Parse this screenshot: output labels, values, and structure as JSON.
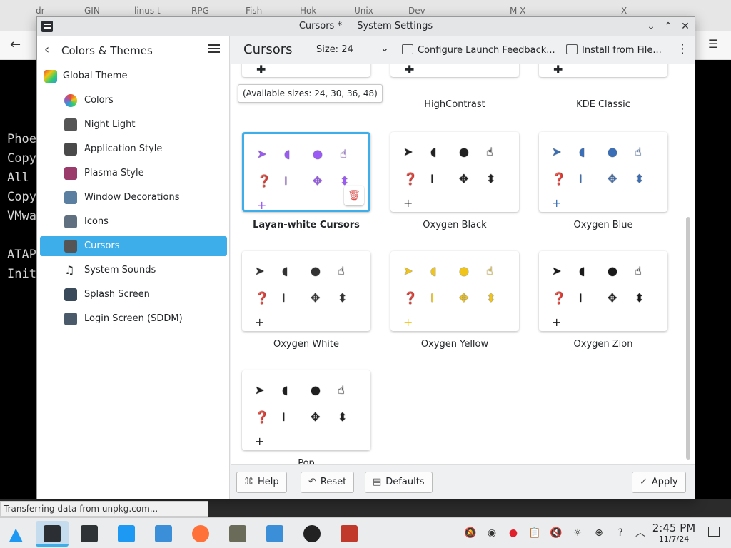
{
  "browser": {
    "tabs": [
      "dr",
      "GIN",
      "linus t",
      "RPG",
      "Fish",
      "Hok",
      "Unix",
      "Dev",
      "M X",
      "",
      "X"
    ],
    "terminal_lines": [
      "Phoe",
      "Copy",
      "All",
      "Copy",
      "VMwa",
      "",
      "ATAP",
      "Init"
    ],
    "status_text": "Transferring data from unpkg.com..."
  },
  "window": {
    "title": "Cursors * — System Settings"
  },
  "sidebar": {
    "title": "Colors & Themes",
    "items": [
      {
        "label": "Global Theme",
        "icon": "global-theme-icon",
        "color": "#e8443a"
      },
      {
        "label": "Colors",
        "icon": "colors-icon",
        "color": "#d04b8f"
      },
      {
        "label": "Night Light",
        "icon": "night-light-icon",
        "color": "#555555"
      },
      {
        "label": "Application Style",
        "icon": "application-style-icon",
        "color": "#4a4a4a"
      },
      {
        "label": "Plasma Style",
        "icon": "plasma-style-icon",
        "color": "#9b3b6b"
      },
      {
        "label": "Window Decorations",
        "icon": "window-decorations-icon",
        "color": "#5a7fa0"
      },
      {
        "label": "Icons",
        "icon": "icons-icon",
        "color": "#607080"
      },
      {
        "label": "Cursors",
        "icon": "cursors-icon",
        "color": "#555555"
      },
      {
        "label": "System Sounds",
        "icon": "system-sounds-icon",
        "color": "#232629"
      },
      {
        "label": "Splash Screen",
        "icon": "splash-screen-icon",
        "color": "#3a4a5a"
      },
      {
        "label": "Login Screen (SDDM)",
        "icon": "login-screen-icon",
        "color": "#4a5a6a"
      }
    ],
    "active_index": 7
  },
  "content": {
    "page_title": "Cursors",
    "size_label": "Size: 24",
    "configure_label": "Configure Launch Feedback...",
    "install_label": "Install from File...",
    "tooltip": "(Available sizes: 24, 30, 36, 48)",
    "top_row_labels": [
      "HighContrast",
      "KDE Classic"
    ],
    "themes": [
      {
        "name": "Layan-white Cursors",
        "selected": true,
        "color": "#9b59f6"
      },
      {
        "name": "Oxygen Black",
        "selected": false,
        "color": "#222222"
      },
      {
        "name": "Oxygen Blue",
        "selected": false,
        "color": "#3a6fb8"
      },
      {
        "name": "Oxygen White",
        "selected": false,
        "color": "#f4f4f4"
      },
      {
        "name": "Oxygen Yellow",
        "selected": false,
        "color": "#f0c419"
      },
      {
        "name": "Oxygen Zion",
        "selected": false,
        "color": "#1a1a1a"
      },
      {
        "name": "Pop",
        "selected": false,
        "color": "#202020"
      }
    ]
  },
  "footer": {
    "help": "Help",
    "reset": "Reset",
    "defaults": "Defaults",
    "apply": "Apply"
  },
  "taskbar": {
    "time": "2:45 PM",
    "date": "11/7/24",
    "apps": [
      "app-launcher-icon",
      "system-settings-icon",
      "konsole-icon",
      "discover-icon",
      "dolphin-icon",
      "firefox-icon",
      "gimp-icon",
      "files-icon",
      "obs-icon",
      "game-icon"
    ],
    "tray": [
      "notifications-muted-icon",
      "obs-tray-icon",
      "record-icon",
      "clipboard-icon",
      "volume-muted-icon",
      "brightness-icon",
      "network-icon",
      "help-icon",
      "expand-tray-icon"
    ]
  },
  "colors": {
    "accent": "#3daee9"
  }
}
